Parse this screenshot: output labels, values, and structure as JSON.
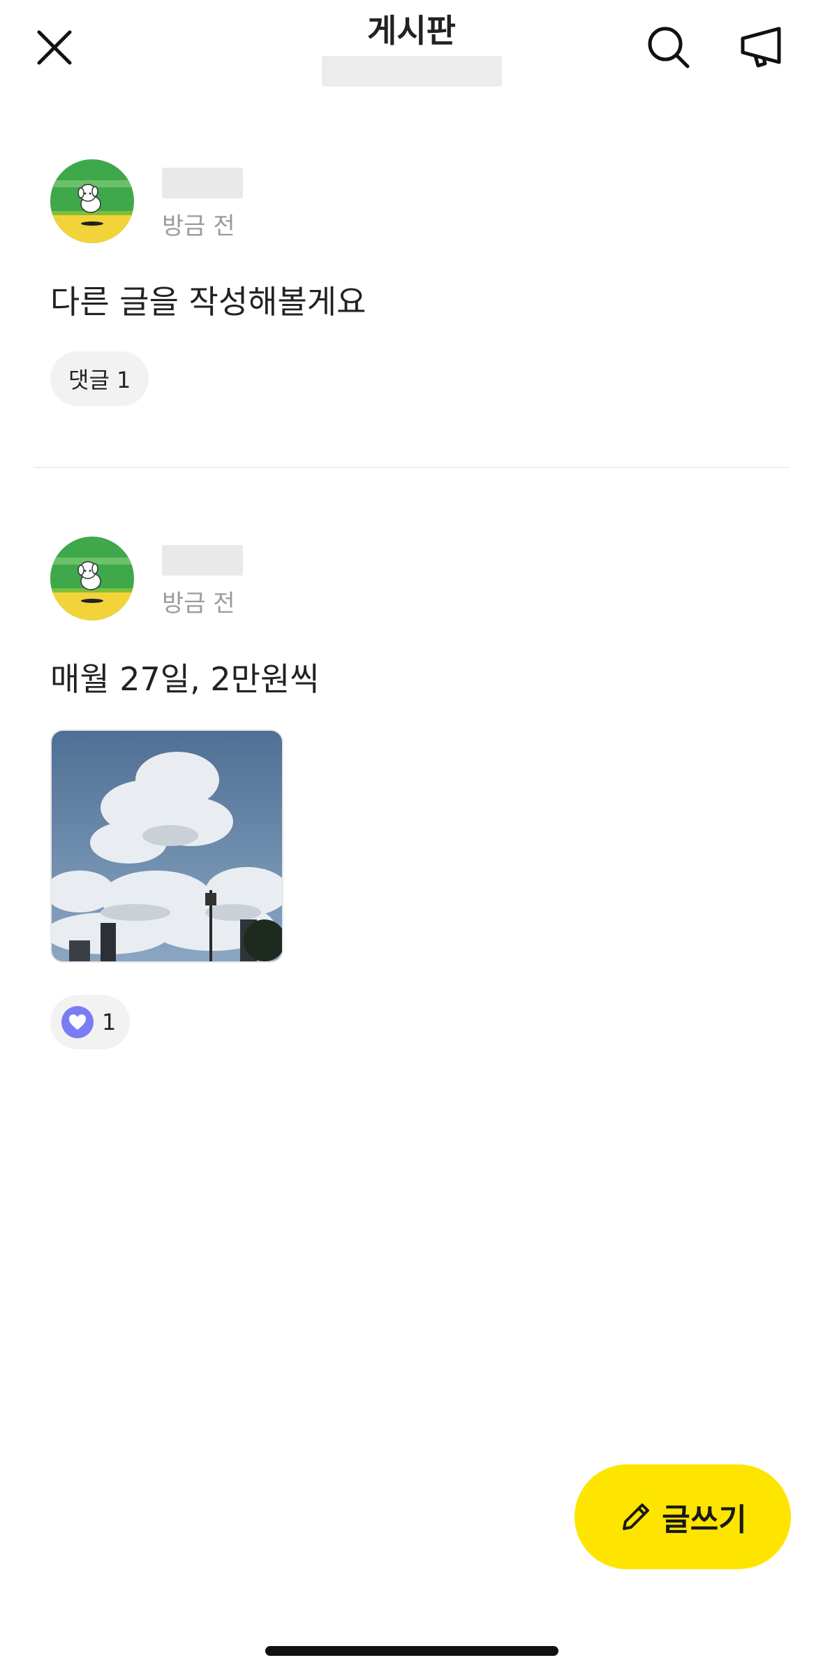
{
  "header": {
    "title": "게시판",
    "close_icon": "close-icon",
    "search_icon": "search-icon",
    "notice_icon": "megaphone-icon"
  },
  "posts": [
    {
      "time": "방금 전",
      "text": "다른 글을 작성해볼게요",
      "comment_chip": "댓글 1"
    },
    {
      "time": "방금 전",
      "text": "매월 27일, 2만원씩",
      "like_count": "1"
    }
  ],
  "write_button": {
    "label": "글쓰기",
    "icon": "pencil-icon",
    "color": "#FEE500"
  },
  "colors": {
    "like_accent": "#7A7CF5"
  }
}
